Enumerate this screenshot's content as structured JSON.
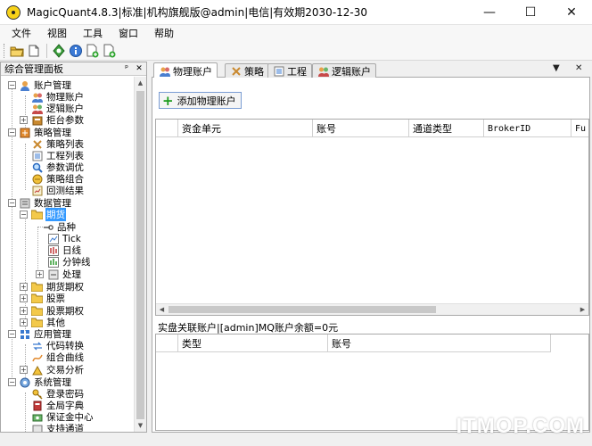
{
  "window": {
    "title": "MagicQuant4.8.3|标准|机构旗舰版@admin|电信|有效期2030-12-30",
    "minimize": "—",
    "maximize": "☐",
    "close": "✕"
  },
  "menu": [
    "文件",
    "视图",
    "工具",
    "窗口",
    "帮助"
  ],
  "toolbar": {
    "icons": [
      "open-folder-icon",
      "new-file-icon",
      "refresh-icon",
      "info-icon",
      "add-document-icon",
      "document-plus-icon"
    ]
  },
  "left_panel": {
    "title": "综合管理面板",
    "pin": "ᵖ",
    "close": "✕",
    "tree": [
      {
        "label": "账户管理",
        "icon": "user-gear-icon",
        "expander": "−"
      },
      {
        "label": "物理账户",
        "icon": "people-icon"
      },
      {
        "label": "逻辑账户",
        "icon": "people-group-icon"
      },
      {
        "label": "柜台参数",
        "icon": "counter-icon",
        "expander": "+"
      },
      {
        "label": "策略管理",
        "icon": "strategy-icon",
        "expander": "−"
      },
      {
        "label": "策略列表",
        "icon": "strategy-list-icon"
      },
      {
        "label": "工程列表",
        "icon": "project-list-icon"
      },
      {
        "label": "参数调优",
        "icon": "magnifier-icon"
      },
      {
        "label": "策略组合",
        "icon": "combine-icon"
      },
      {
        "label": "回测结果",
        "icon": "result-icon"
      },
      {
        "label": "数据管理",
        "icon": "data-icon",
        "expander": "−"
      },
      {
        "label": "期货",
        "icon": "folder-icon",
        "expander": "−",
        "selected": true
      },
      {
        "label": "品种",
        "icon": "key-icon"
      },
      {
        "label": "Tick",
        "icon": "tick-chart-icon"
      },
      {
        "label": "日线",
        "icon": "daily-chart-icon"
      },
      {
        "label": "分钟线",
        "icon": "minute-chart-icon"
      },
      {
        "label": "处理",
        "icon": "process-icon",
        "expander": "+"
      },
      {
        "label": "期货期权",
        "icon": "folder-icon",
        "expander": "+"
      },
      {
        "label": "股票",
        "icon": "folder-icon",
        "expander": "+"
      },
      {
        "label": "股票期权",
        "icon": "folder-icon",
        "expander": "+"
      },
      {
        "label": "其他",
        "icon": "folder-icon",
        "expander": "+"
      },
      {
        "label": "应用管理",
        "icon": "app-grid-icon",
        "expander": "−"
      },
      {
        "label": "代码转换",
        "icon": "convert-icon"
      },
      {
        "label": "组合曲线",
        "icon": "curve-icon"
      },
      {
        "label": "交易分析",
        "icon": "analysis-icon",
        "expander": "+"
      },
      {
        "label": "系统管理",
        "icon": "system-icon",
        "expander": "−"
      },
      {
        "label": "登录密码",
        "icon": "key-icon"
      },
      {
        "label": "全局字典",
        "icon": "dictionary-icon"
      },
      {
        "label": "保证金中心",
        "icon": "margin-icon"
      },
      {
        "label": "支持通道",
        "icon": "channel-icon"
      }
    ]
  },
  "tabs": [
    {
      "label": "物理账户",
      "icon": "people-icon",
      "active": true
    },
    {
      "label": "策略",
      "icon": "strategy-icon"
    },
    {
      "label": "工程",
      "icon": "project-list-icon"
    },
    {
      "label": "逻辑账户",
      "icon": "people-group-icon"
    }
  ],
  "tab_controls": {
    "dropdown": "▼",
    "close": "✕"
  },
  "content": {
    "add_button": "添加物理账户",
    "accounts_table": {
      "columns": [
        "",
        "资金单元",
        "账号",
        "通道类型",
        "BrokerID",
        "Fu"
      ]
    },
    "linked_label": "实盘关联账户|[admin]MQ账户余额=0元",
    "linked_table": {
      "columns": [
        "",
        "类型",
        "账号"
      ]
    }
  },
  "watermark": "ITMOP.COM"
}
